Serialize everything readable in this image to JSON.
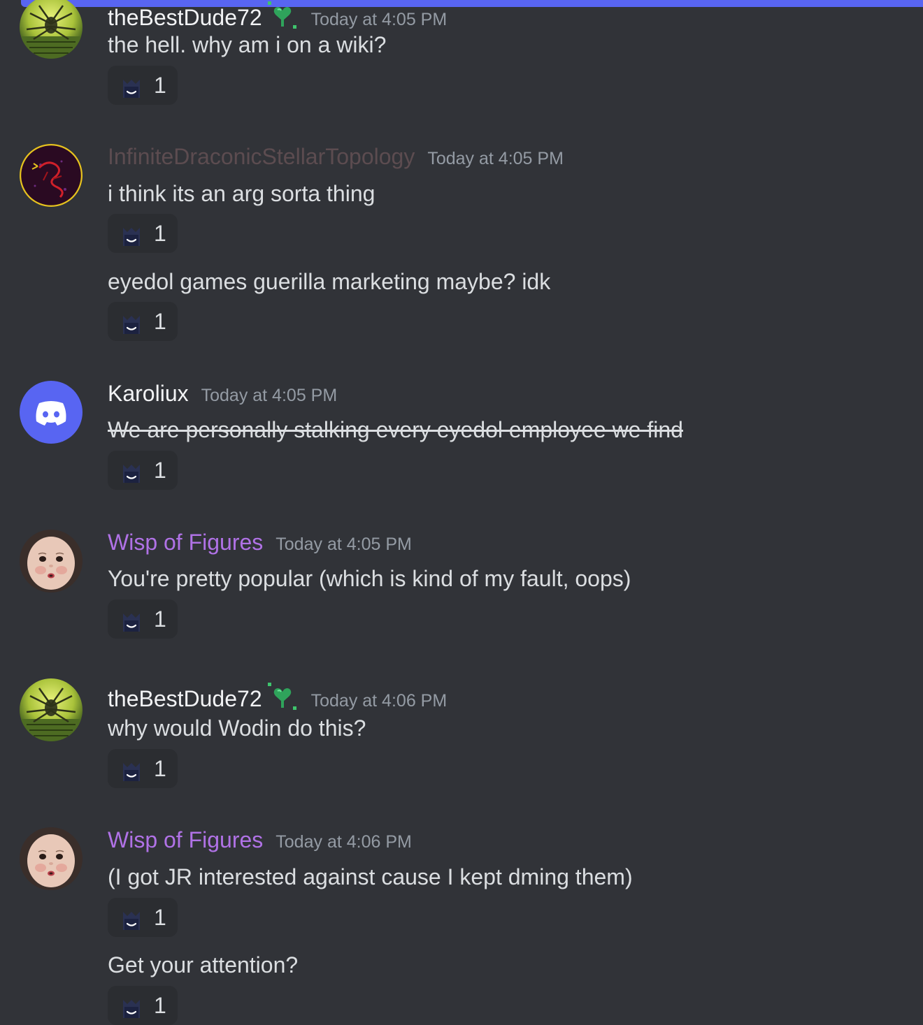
{
  "channel": {
    "accent": "#5865f2",
    "background": "#313338"
  },
  "messages": [
    {
      "author": "theBestDude72",
      "author_color": "#f2f3f5",
      "has_badge": true,
      "timestamp": "Today at 4:05 PM",
      "lines": [
        {
          "text": "the hell. why am i on a wiki?",
          "reaction_count": "1"
        }
      ]
    },
    {
      "author": "InfiniteDraconicStellarTopology",
      "author_color": "#5c4c50",
      "timestamp": "Today at 4:05 PM",
      "lines": [
        {
          "text": "i think its an arg sorta thing",
          "reaction_count": "1"
        },
        {
          "text": "eyedol games guerilla marketing maybe? idk",
          "reaction_count": "1"
        }
      ]
    },
    {
      "author": "Karoliux",
      "author_color": "#f2f3f5",
      "timestamp": "Today at 4:05 PM",
      "lines": [
        {
          "text": "We are personally stalking every eyedol employee we find",
          "strikethrough": true,
          "reaction_count": "1"
        }
      ]
    },
    {
      "author": "Wisp of Figures",
      "author_color": "#b072e6",
      "timestamp": "Today at 4:05 PM",
      "lines": [
        {
          "text": "You're pretty popular (which is kind of my fault, oops)",
          "reaction_count": "1"
        }
      ]
    },
    {
      "author": "theBestDude72",
      "author_color": "#f2f3f5",
      "has_badge": true,
      "timestamp": "Today at 4:06 PM",
      "lines": [
        {
          "text": "why would Wodin do this?",
          "reaction_count": "1"
        }
      ]
    },
    {
      "author": "Wisp of Figures",
      "author_color": "#b072e6",
      "timestamp": "Today at 4:06 PM",
      "lines": [
        {
          "text": "(I got JR interested against cause I kept dming them)",
          "reaction_count": "1"
        },
        {
          "text": "Get your attention?",
          "reaction_count": "1"
        }
      ]
    }
  ],
  "icons": {
    "reaction_emoji": "smiling-hooded-figure-icon",
    "badge": "green-heart-sprout-badge-icon",
    "discord_default_avatar": "discord-logo-icon"
  }
}
